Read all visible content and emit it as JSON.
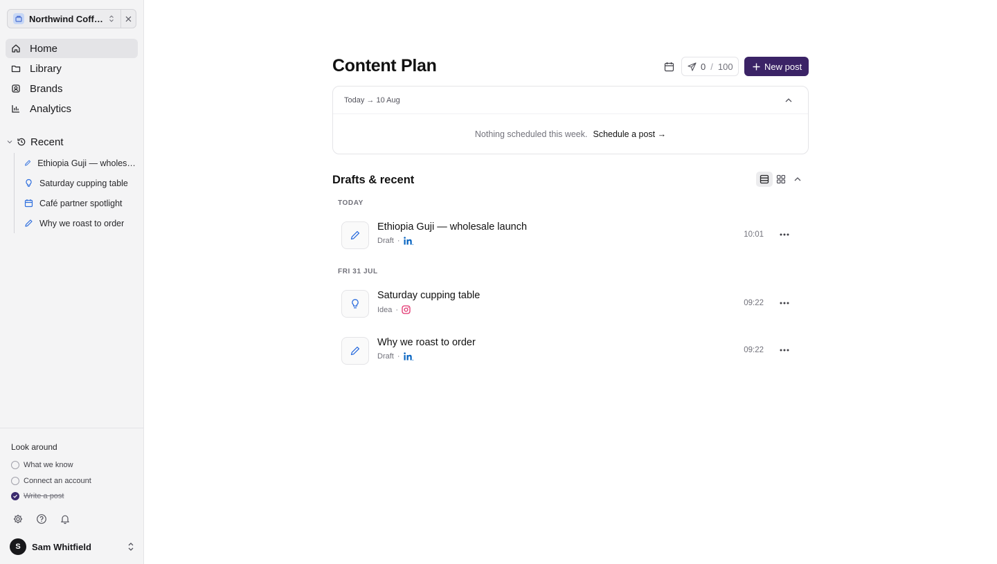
{
  "workspace": {
    "name": "Northwind Coffee Co."
  },
  "nav": {
    "items": [
      {
        "label": "Home",
        "icon": "home-icon",
        "active": true
      },
      {
        "label": "Library",
        "icon": "folder-icon",
        "active": false
      },
      {
        "label": "Brands",
        "icon": "brand-icon",
        "active": false
      },
      {
        "label": "Analytics",
        "icon": "bar-chart-icon",
        "active": false
      }
    ]
  },
  "recent": {
    "label": "Recent",
    "items": [
      {
        "label": "Ethiopia Guji — wholesale launch",
        "icon": "pencil-icon"
      },
      {
        "label": "Saturday cupping table",
        "icon": "lightbulb-icon"
      },
      {
        "label": "Café partner spotlight",
        "icon": "calendar-icon"
      },
      {
        "label": "Why we roast to order",
        "icon": "pencil-icon"
      }
    ]
  },
  "look_around": {
    "title": "Look around",
    "items": [
      {
        "label": "What we know",
        "done": false
      },
      {
        "label": "Connect an account",
        "done": false
      },
      {
        "label": "Write a post",
        "done": true
      }
    ]
  },
  "user": {
    "initial": "S",
    "name": "Sam Whitfield"
  },
  "main": {
    "title": "Content Plan",
    "quota": {
      "used": "0",
      "sep": "/",
      "max": "100"
    },
    "new_post_label": "New post",
    "week": {
      "range": "Today → 10 Aug",
      "empty_text": "Nothing scheduled this week.",
      "link_text": "Schedule a post →"
    },
    "drafts": {
      "title": "Drafts & recent",
      "groups": [
        {
          "label": "TODAY",
          "posts": [
            {
              "title": "Ethiopia Guji — wholesale launch",
              "status": "Draft",
              "network": "linkedin",
              "time": "10:01",
              "icon": "pencil-icon"
            }
          ]
        },
        {
          "label": "FRI 31 JUL",
          "posts": [
            {
              "title": "Saturday cupping table",
              "status": "Idea",
              "network": "instagram",
              "time": "09:22",
              "icon": "lightbulb-icon"
            },
            {
              "title": "Why we roast to order",
              "status": "Draft",
              "network": "linkedin",
              "time": "09:22",
              "icon": "pencil-icon"
            }
          ]
        }
      ]
    }
  },
  "colors": {
    "accent": "#3b2366",
    "linkedin": "#0a66c2",
    "instagram": "#e1306c",
    "icon_blue": "#2f6fde"
  }
}
